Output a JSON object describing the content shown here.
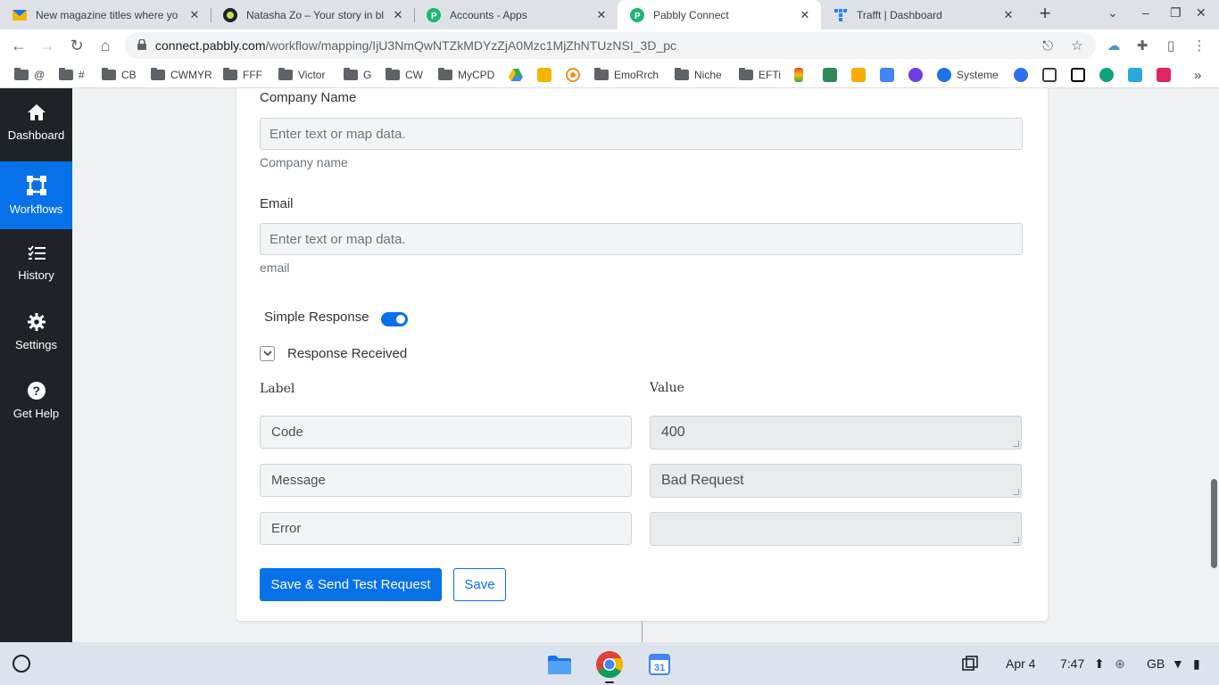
{
  "browser": {
    "tabs": [
      {
        "title": "New magazine titles where yo",
        "favicon": "mail-icon",
        "active": false
      },
      {
        "title": "Natasha Zo – Your story in bl",
        "favicon": "circle-icon",
        "active": false
      },
      {
        "title": "Accounts - Apps",
        "favicon": "pabbly-icon",
        "active": false
      },
      {
        "title": "Pabbly Connect",
        "favicon": "pabbly-icon",
        "active": true
      },
      {
        "title": "Trafft | Dashboard",
        "favicon": "trafft-icon",
        "active": false
      }
    ],
    "url_host": "connect.pabbly.com",
    "url_path": "/workflow/mapping/IjU3NmQwNTZkMDYzZjA0Mzc1MjZhNTUzNSI_3D_pc",
    "bookmarks": [
      "@",
      "#",
      "CB",
      "CWMYR",
      "FFF",
      "Victor",
      "G",
      "CW",
      "MyCPD",
      "EmoRrch",
      "Niche",
      "EFTi",
      "Systeme"
    ],
    "bookmarks_overflow": "»"
  },
  "sidebar": {
    "items": [
      {
        "label": "Dashboard",
        "icon": "home-icon",
        "active": false
      },
      {
        "label": "Workflows",
        "icon": "workflow-icon",
        "active": true
      },
      {
        "label": "History",
        "icon": "list-check-icon",
        "active": false
      },
      {
        "label": "Settings",
        "icon": "gear-icon",
        "active": false
      },
      {
        "label": "Get Help",
        "icon": "question-icon",
        "active": false
      }
    ]
  },
  "form": {
    "company_label": "Company Name",
    "company_placeholder": "Enter text or map data.",
    "company_help": "Company name",
    "email_label": "Email",
    "email_placeholder": "Enter text or map data.",
    "email_help": "email",
    "simple_response_label": "Simple Response",
    "simple_response_on": true,
    "response_section_title": "Response Received",
    "col_label": "Label",
    "col_value": "Value",
    "response_rows": [
      {
        "label": "Code",
        "value": "400"
      },
      {
        "label": "Message",
        "value": "Bad Request"
      },
      {
        "label": "Error",
        "value": ""
      }
    ],
    "save_send_button": "Save & Send Test Request",
    "save_button": "Save"
  },
  "shelf": {
    "date": "Apr 4",
    "time": "7:47",
    "keyboard": "GB",
    "apps": [
      "files-icon",
      "chrome-icon",
      "calendar-icon"
    ]
  },
  "colors": {
    "accent": "#0771e9",
    "sidebar_bg": "#1f2327"
  }
}
